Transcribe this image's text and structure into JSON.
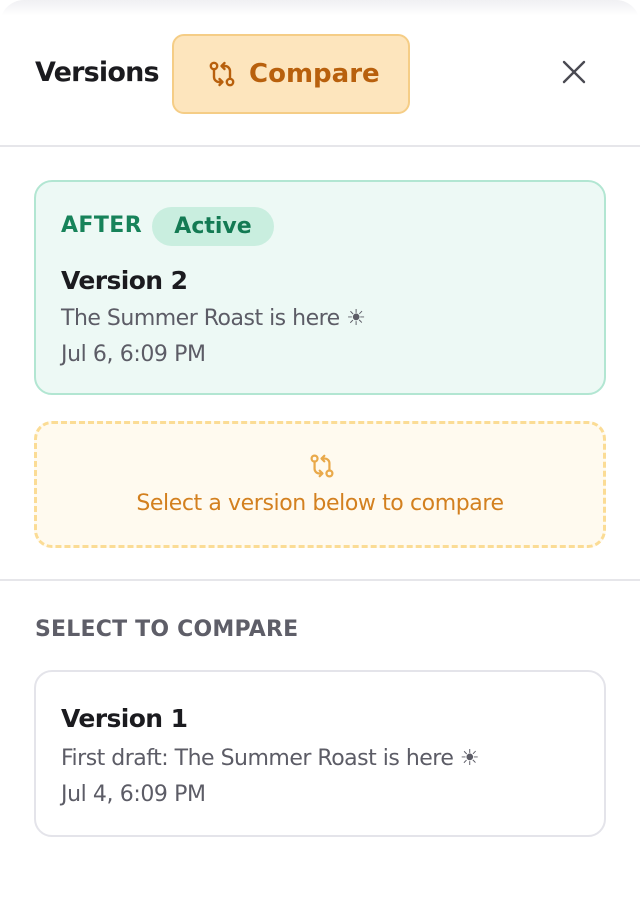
{
  "header": {
    "title": "Versions",
    "compare_label": "Compare"
  },
  "active_version": {
    "side_label": "AFTER",
    "badge": "Active",
    "name": "Version 2",
    "description": "The Summer Roast is here ☀",
    "date": "Jul 6, 6:09 PM"
  },
  "compare_prompt": {
    "text": "Select a version below to compare"
  },
  "select_section": {
    "label": "SELECT TO COMPARE",
    "versions": [
      {
        "name": "Version 1",
        "description": "First draft: The Summer Roast is here ☀",
        "date": "Jul 4, 6:09 PM"
      }
    ]
  },
  "colors": {
    "accent_orange": "#b8600d",
    "compare_bg": "#fde5bd",
    "active_green": "#17835a",
    "active_bg": "#edf9f5",
    "prompt_orange": "#d3801f"
  },
  "icons": {
    "compare": "git-compare-icon",
    "close": "close-icon"
  }
}
